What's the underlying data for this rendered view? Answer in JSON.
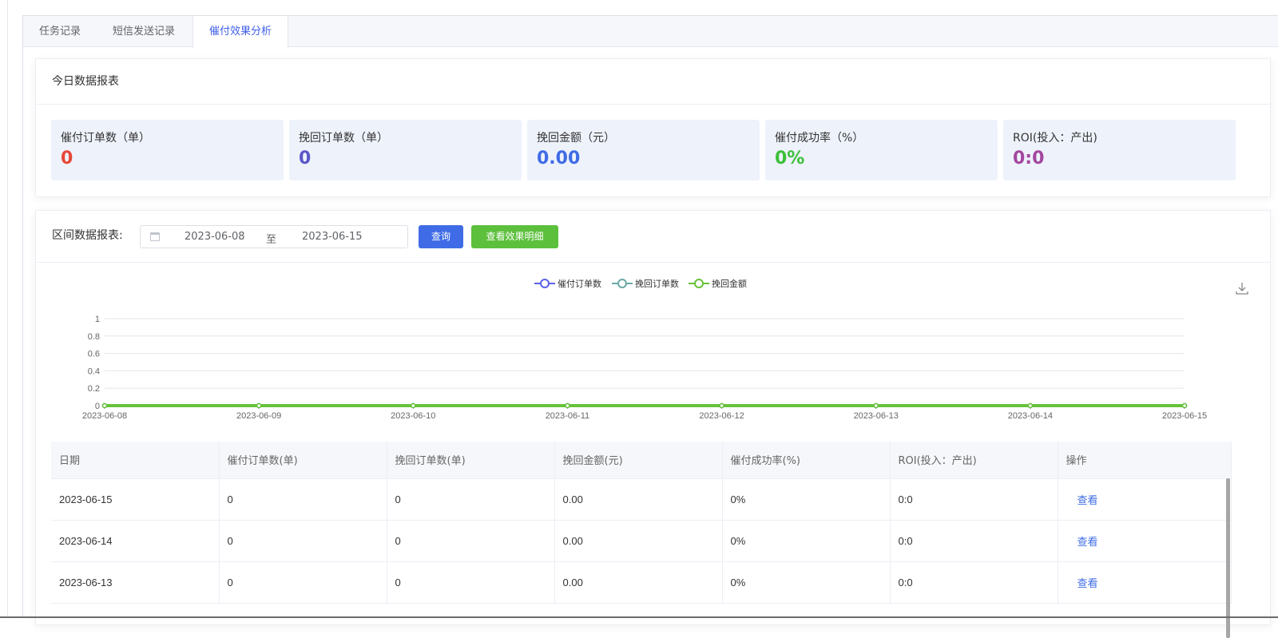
{
  "tabs": [
    {
      "label": "任务记录",
      "active": false
    },
    {
      "label": "短信发送记录",
      "active": false
    },
    {
      "label": "催付效果分析",
      "active": true
    }
  ],
  "today": {
    "title": "今日数据报表",
    "stats": [
      {
        "label": "催付订单数（单）",
        "value": "0",
        "color": "#e8473a"
      },
      {
        "label": "挽回订单数（单）",
        "value": "0",
        "color": "#5b56c7"
      },
      {
        "label": "挽回金额（元）",
        "value": "0.00",
        "color": "#3f6ce6"
      },
      {
        "label": "催付成功率（%）",
        "value": "0%",
        "color": "#3cbf3a"
      },
      {
        "label": "ROI(投入：产出)",
        "value": "0:0",
        "color": "#a3479e"
      }
    ]
  },
  "range": {
    "label": "区间数据报表:",
    "start": "2023-06-08",
    "separator": "至",
    "end": "2023-06-15",
    "query_label": "查询",
    "detail_label": "查看效果明细"
  },
  "chart_data": {
    "type": "line",
    "x": [
      "2023-06-08",
      "2023-06-09",
      "2023-06-10",
      "2023-06-11",
      "2023-06-12",
      "2023-06-13",
      "2023-06-14",
      "2023-06-15"
    ],
    "yticks": [
      "0",
      "0.2",
      "0.4",
      "0.6",
      "0.8",
      "1"
    ],
    "ylim": [
      0,
      1
    ],
    "series": [
      {
        "name": "催付订单数",
        "color": "#5b61e8",
        "values": [
          0,
          0,
          0,
          0,
          0,
          0,
          0,
          0
        ]
      },
      {
        "name": "挽回订单数",
        "color": "#6ba9a5",
        "values": [
          0,
          0,
          0,
          0,
          0,
          0,
          0,
          0
        ]
      },
      {
        "name": "挽回金额",
        "color": "#67c23a",
        "values": [
          0,
          0,
          0,
          0,
          0,
          0,
          0,
          0
        ]
      }
    ],
    "legend": "top-center",
    "grid": true
  },
  "table": {
    "columns": [
      "日期",
      "催付订单数(单)",
      "挽回订单数(单)",
      "挽回金额(元)",
      "催付成功率(%)",
      "ROI(投入：产出)",
      "操作"
    ],
    "rows": [
      [
        "2023-06-15",
        "0",
        "0",
        "0.00",
        "0%",
        "0:0",
        "查看"
      ],
      [
        "2023-06-14",
        "0",
        "0",
        "0.00",
        "0%",
        "0:0",
        "查看"
      ],
      [
        "2023-06-13",
        "0",
        "0",
        "0.00",
        "0%",
        "0:0",
        "查看"
      ]
    ]
  }
}
